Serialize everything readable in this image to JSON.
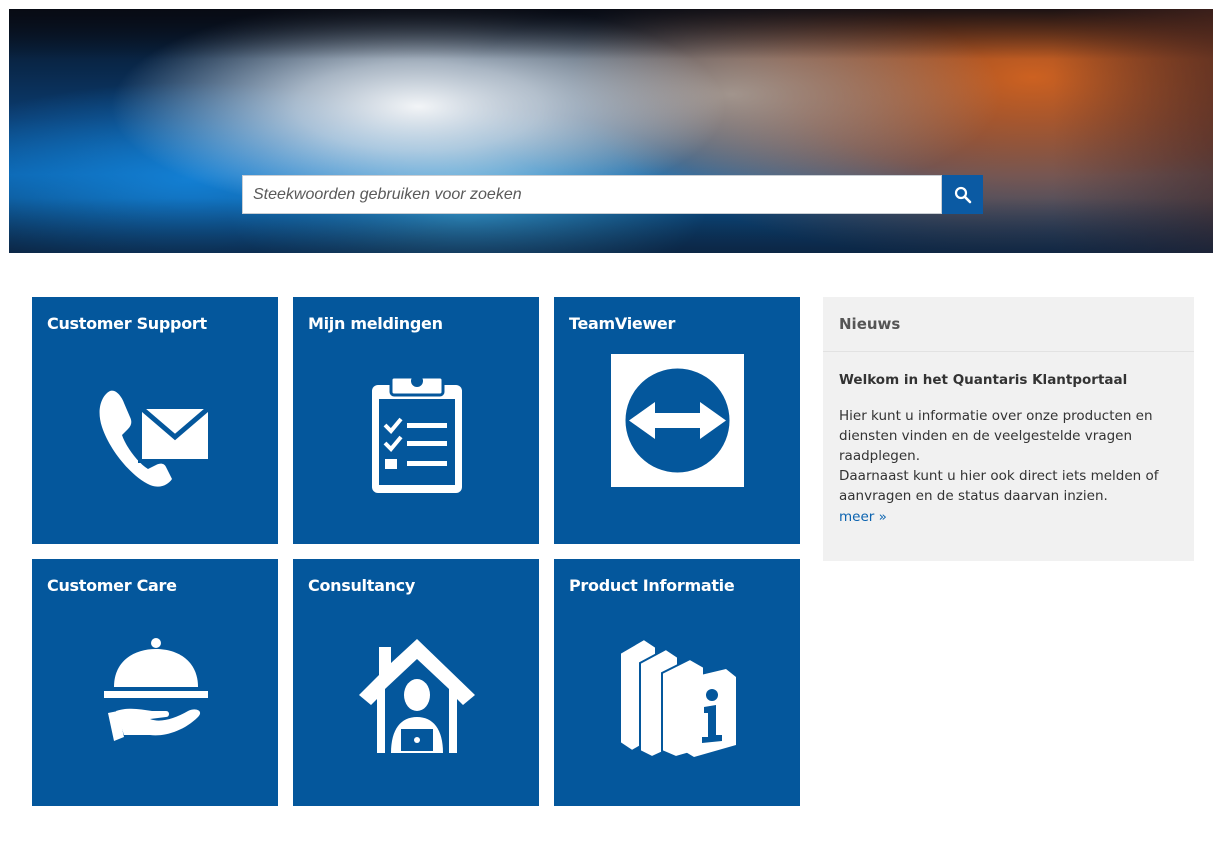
{
  "search": {
    "placeholder": "Steekwoorden gebruiken voor zoeken",
    "icon": "search-icon"
  },
  "tiles": [
    {
      "label": "Customer Support",
      "icon": "phone-envelope-icon"
    },
    {
      "label": "Mijn meldingen",
      "icon": "clipboard-checklist-icon"
    },
    {
      "label": "TeamViewer",
      "icon": "teamviewer-logo-icon"
    },
    {
      "label": "Customer Care",
      "icon": "serving-cloche-hand-icon"
    },
    {
      "label": "Consultancy",
      "icon": "house-person-laptop-icon"
    },
    {
      "label": "Product Informatie",
      "icon": "books-info-icon"
    }
  ],
  "news": {
    "heading": "Nieuws",
    "title": "Welkom in het Quantaris Klantportaal",
    "line1": "Hier kunt u informatie over onze producten en diensten vinden en de veelgestelde vragen raadplegen.",
    "line2": "Daarnaast kunt u hier ook direct iets melden of aanvragen en de status daarvan inzien.",
    "more": "meer »"
  },
  "colors": {
    "tile": "#04579c",
    "search_button": "#0b5aa3",
    "link": "#0b63b0",
    "news_bg": "#f1f1f1"
  }
}
